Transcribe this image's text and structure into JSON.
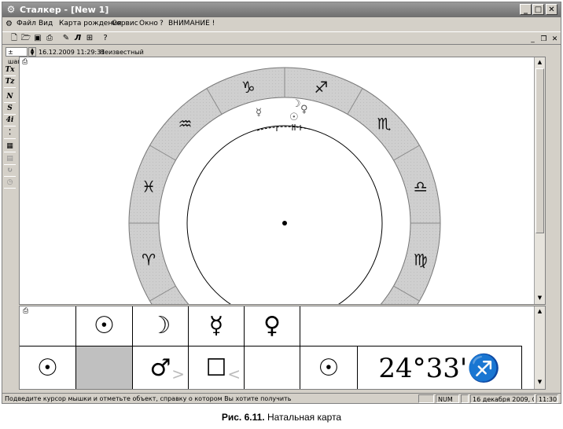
{
  "window": {
    "title": "Сталкер - [New 1]",
    "title_icon": "gear-icon"
  },
  "menu": {
    "items": [
      "Файл",
      "Вид",
      "Карта рождения",
      "Сервис",
      "Окно",
      "?",
      "ВНИМАНИЕ !"
    ]
  },
  "datebar": {
    "step_value": "± шаг",
    "datetime": "16.12.2009 11:29:31",
    "place": "Неизвестный"
  },
  "toolbar_icons": [
    "new-document-icon",
    "open-folder-icon",
    "save-icon",
    "print-icon",
    "edit-icon",
    "transit-icon",
    "grid-icon",
    "help-icon"
  ],
  "left_toolbar": {
    "labels": [
      "Tx",
      "Tz",
      "N",
      "S",
      "4i"
    ]
  },
  "chart": {
    "signs": [
      {
        "name": "capricorn",
        "glyph": "♑"
      },
      {
        "name": "sagittarius",
        "glyph": "♐"
      },
      {
        "name": "scorpio",
        "glyph": "♏"
      },
      {
        "name": "libra",
        "glyph": "♎"
      },
      {
        "name": "virgo",
        "glyph": "♍"
      },
      {
        "name": "aquarius",
        "glyph": "♒"
      },
      {
        "name": "pisces",
        "glyph": "♓"
      },
      {
        "name": "aries",
        "glyph": "♈"
      }
    ],
    "planets": [
      {
        "name": "mercury",
        "glyph": "☿"
      },
      {
        "name": "moon",
        "glyph": "☽"
      },
      {
        "name": "sun",
        "glyph": "☉"
      },
      {
        "name": "venus",
        "glyph": "♀"
      }
    ]
  },
  "aspect_grid": {
    "header_row": [
      "☉",
      "☽",
      "☿",
      "♀"
    ],
    "row_planet": "☉",
    "aspect_cells": [
      "♂",
      "☐"
    ],
    "position_planet": "☉",
    "position_text": "24°33'♐"
  },
  "statusbar": {
    "hint": "Подведите курсор мышки и отметьте объект, справку о котором Вы хотите получить",
    "num": "NUM",
    "date": "16 декабря 2009, Ср.",
    "time": "11:30"
  },
  "caption": {
    "label": "Рис. 6.11.",
    "text": "Натальная карта"
  }
}
